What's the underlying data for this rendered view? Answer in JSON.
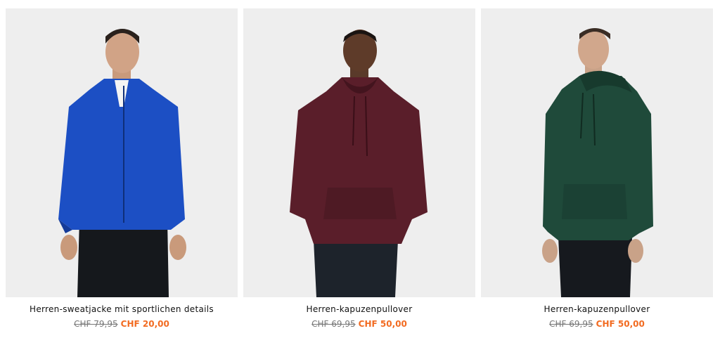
{
  "products": [
    {
      "title": "Herren-sweatjacke mit sportlichen details",
      "old_price": "CHF 79,95",
      "new_price": "CHF 20,00",
      "image": "model-blue-track-jacket",
      "color": "#1c4fc4"
    },
    {
      "title": "Herren-kapuzenpullover",
      "old_price": "CHF 69,95",
      "new_price": "CHF 50,00",
      "image": "model-burgundy-hoodie",
      "color": "#5a1e2a"
    },
    {
      "title": "Herren-kapuzenpullover",
      "old_price": "CHF 69,95",
      "new_price": "CHF 50,00",
      "image": "model-green-hoodie",
      "color": "#1f4a3a"
    }
  ],
  "colors": {
    "sale_price": "#f26b21",
    "old_price": "#777777",
    "image_background": "#eeeeee"
  }
}
